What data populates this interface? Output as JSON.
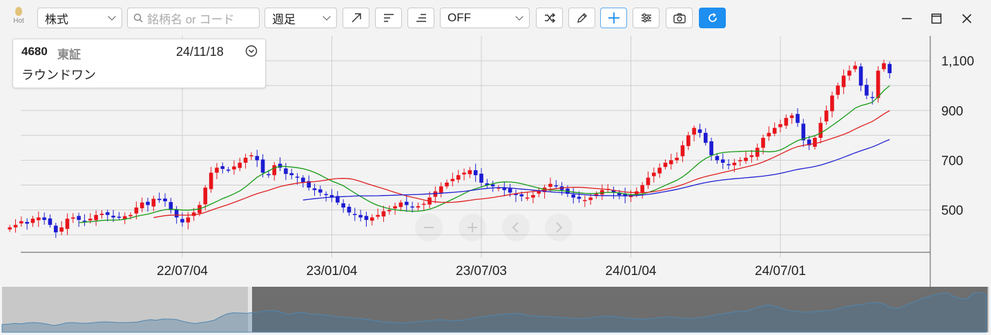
{
  "toolbar": {
    "hot_label": "Hot",
    "market_select": "株式",
    "search_placeholder": "銘柄名 or コード",
    "period_select": "週足",
    "overlay_select": "OFF"
  },
  "info_card": {
    "code": "4680",
    "exchange": "東証",
    "date": "24/11/18",
    "name": "ラウンドワン"
  },
  "colors": {
    "up": "#e8141b",
    "down": "#1c1cd2",
    "ma_short": "#149b14",
    "ma_mid": "#e01e1e",
    "ma_long": "#1e1ed2",
    "accent": "#1e8ff0"
  },
  "chart_data": {
    "type": "candlestick",
    "x_axis": {
      "tick_labels": [
        "22/07/04",
        "23/01/04",
        "23/07/03",
        "24/01/04",
        "24/07/01"
      ]
    },
    "y_axis": {
      "tick_labels": [
        "500",
        "700",
        "900",
        "1,100"
      ],
      "ticks": [
        500,
        700,
        900,
        1100
      ],
      "range": [
        330,
        1200
      ],
      "gridlines": [
        400,
        500,
        600,
        700,
        800,
        900,
        1000,
        1100
      ]
    },
    "grid": true,
    "weeks_per_axis_label": 26,
    "first_week_offset": -30,
    "series": [
      {
        "name": "candles",
        "closes": [
          430,
          440,
          455,
          445,
          465,
          470,
          460,
          440,
          410,
          430,
          465,
          470,
          460,
          455,
          465,
          480,
          485,
          480,
          470,
          470,
          475,
          480,
          510,
          530,
          520,
          545,
          540,
          535,
          500,
          470,
          450,
          470,
          490,
          520,
          590,
          650,
          670,
          665,
          660,
          675,
          690,
          710,
          720,
          700,
          650,
          640,
          680,
          670,
          645,
          640,
          630,
          610,
          590,
          580,
          570,
          560,
          550,
          530,
          510,
          490,
          480,
          470,
          460,
          470,
          480,
          495,
          500,
          515,
          530,
          520,
          510,
          515,
          525,
          550,
          575,
          595,
          610,
          625,
          640,
          650,
          660,
          640,
          610,
          600,
          595,
          590,
          580,
          570,
          560,
          555,
          550,
          560,
          575,
          590,
          605,
          595,
          580,
          565,
          550,
          545,
          540,
          550,
          565,
          580,
          585,
          570,
          560,
          555,
          560,
          575,
          600,
          630,
          650,
          670,
          690,
          700,
          710,
          760,
          800,
          830,
          810,
          770,
          720,
          700,
          690,
          680,
          690,
          700,
          710,
          720,
          750,
          790,
          810,
          830,
          845,
          870,
          880,
          850,
          780,
          760,
          790,
          850,
          900,
          960,
          1000,
          1040,
          1060,
          1080,
          1000,
          960,
          950,
          1060,
          1090,
          1050
        ]
      },
      {
        "name": "MA short (green)"
      },
      {
        "name": "MA mid (red)"
      },
      {
        "name": "MA long (blue)"
      }
    ]
  }
}
